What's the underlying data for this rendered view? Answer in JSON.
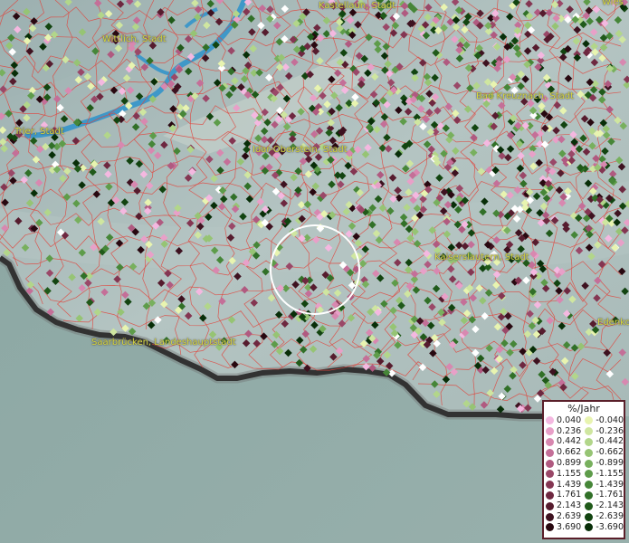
{
  "cities": [
    {
      "id": "kastellaun",
      "label": "Kastellaun, Stadt"
    },
    {
      "id": "wiesbaden",
      "label": "Wies"
    },
    {
      "id": "wittlich",
      "label": "Wittlich, Stadt"
    },
    {
      "id": "bad-kreuznach",
      "label": "Bad Kreuznach, Stadt"
    },
    {
      "id": "trier",
      "label": "Trier, Stadt"
    },
    {
      "id": "idar-oberstein",
      "label": "Idar-Oberstein, Stadt"
    },
    {
      "id": "kaiserslautern",
      "label": "Kaiserslautern, Stadt"
    },
    {
      "id": "saarbruecken",
      "label": "Saarbrücken, Landeshauptstadt"
    },
    {
      "id": "edenkoben",
      "label": "Edenko"
    }
  ],
  "legend": {
    "title": "%/Jahr",
    "positive": [
      {
        "value": "0.040",
        "color": "#f4b8e0"
      },
      {
        "value": "0.236",
        "color": "#e8a0c8"
      },
      {
        "value": "0.442",
        "color": "#d888b0"
      },
      {
        "value": "0.662",
        "color": "#c46f98"
      },
      {
        "value": "0.899",
        "color": "#b05a80"
      },
      {
        "value": "1.155",
        "color": "#9a4868"
      },
      {
        "value": "1.439",
        "color": "#843652"
      },
      {
        "value": "1.761",
        "color": "#6e2840"
      },
      {
        "value": "2.143",
        "color": "#561c2e"
      },
      {
        "value": "2.639",
        "color": "#3e1220"
      },
      {
        "value": "3.690",
        "color": "#280810"
      }
    ],
    "negative": [
      {
        "value": "-0.040",
        "color": "#e8f4b0"
      },
      {
        "value": "-0.236",
        "color": "#cfe6a0"
      },
      {
        "value": "-0.442",
        "color": "#b2d68a"
      },
      {
        "value": "-0.662",
        "color": "#96c474"
      },
      {
        "value": "-0.899",
        "color": "#78b05e"
      },
      {
        "value": "-1.155",
        "color": "#5e9c4a"
      },
      {
        "value": "-1.439",
        "color": "#468638"
      },
      {
        "value": "-1.761",
        "color": "#317028"
      },
      {
        "value": "-2.143",
        "color": "#205a1a"
      },
      {
        "value": "-2.639",
        "color": "#124410"
      },
      {
        "value": "-3.690",
        "color": "#082e08"
      }
    ]
  }
}
